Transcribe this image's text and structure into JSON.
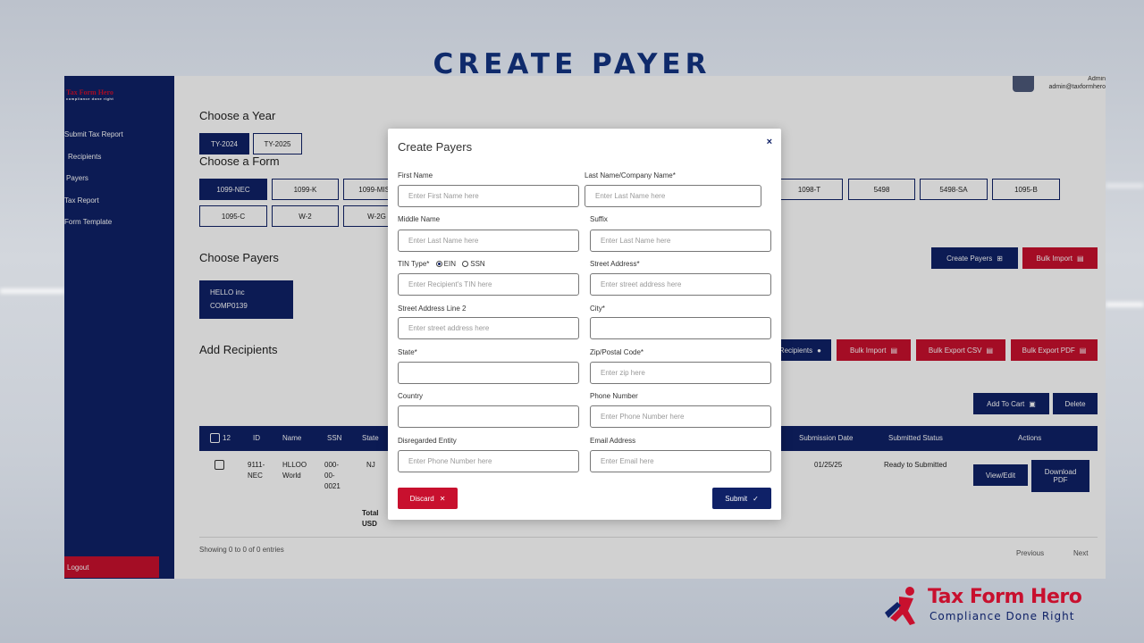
{
  "slide_title": "CREATE PAYER",
  "sidebar": {
    "logo_name": "Tax Form Hero",
    "logo_tag": "compliance done right",
    "items": [
      {
        "label": "Submit Tax Report"
      },
      {
        "label": "Recipients"
      },
      {
        "label": "Payers"
      },
      {
        "label": "Tax Report"
      },
      {
        "label": "Form Template"
      }
    ],
    "logout": "Logout"
  },
  "user": {
    "name": "Admin",
    "email": "admin@taxformhero"
  },
  "year": {
    "heading": "Choose a Year",
    "options": [
      "TY-2024",
      "TY-2025"
    ]
  },
  "form": {
    "heading": "Choose a Form",
    "row1": [
      "1099-NEC",
      "1099-K",
      "1099-MISC",
      "1098-T",
      "5498",
      "5498-SA",
      "1095-B"
    ],
    "row2": [
      "1095-C",
      "W-2",
      "W-2G"
    ]
  },
  "payers": {
    "heading": "Choose Payers",
    "create_btn": "Create Payers",
    "bulk_btn": "Bulk Import",
    "card_name": "HELLO inc",
    "card_id": "COMP0139"
  },
  "recipients": {
    "heading": "Add Recipients",
    "add_btn": "Recipients",
    "bulk_import": "Bulk Import",
    "export_csv": "Bulk Export CSV",
    "export_pdf": "Bulk Export PDF",
    "add_cart": "Add To Cart",
    "delete": "Delete"
  },
  "table": {
    "headers": {
      "count": "12",
      "id": "ID",
      "name": "Name",
      "ssn": "SSN",
      "state": "State",
      "submission_date": "Submission Date",
      "status": "Submitted Status",
      "actions": "Actions"
    },
    "row": {
      "id": "9111-NEC",
      "name": "HLLOO World",
      "ssn": "000-00-0021",
      "state": "NJ",
      "date": "01/25/25",
      "status": "Ready to Submitted",
      "view": "View/Edit",
      "download": "Download PDF"
    },
    "total": "Total USD",
    "showing": "Showing 0 to 0 of 0 entries",
    "previous": "Previous",
    "next": "Next"
  },
  "modal": {
    "title": "Create Payers",
    "close": "×",
    "first_name": {
      "label": "First Name",
      "placeholder": "Enter First Name here"
    },
    "last_name": {
      "label": "Last Name/Company Name*",
      "placeholder": "Enter Last Name here"
    },
    "middle_name": {
      "label": "Middle Name",
      "placeholder": "Enter Last Name here"
    },
    "suffix": {
      "label": "Suffix",
      "placeholder": "Enter Last Name here"
    },
    "tin": {
      "label": "TIN Type*",
      "ein": "EIN",
      "ssn": "SSN",
      "placeholder": "Enter Recipient's TIN here"
    },
    "street": {
      "label": "Street Address*",
      "placeholder": "Enter street address here"
    },
    "street2": {
      "label": "Street Address Line 2",
      "placeholder": "Enter street address here"
    },
    "city": {
      "label": "City*",
      "placeholder": ""
    },
    "state": {
      "label": "State*",
      "placeholder": ""
    },
    "zip": {
      "label": "Zip/Postal Code*",
      "placeholder": "Enter zip here"
    },
    "country": {
      "label": "Country",
      "placeholder": ""
    },
    "phone": {
      "label": "Phone Number",
      "placeholder": "Enter Phone Number here"
    },
    "disregarded": {
      "label": "Disregarded Entity",
      "placeholder": "Enter Phone Number here"
    },
    "email": {
      "label": "Email Address",
      "placeholder": "Enter Email here"
    },
    "discard": "Discard",
    "submit": "Submit"
  },
  "brand": {
    "name": "Tax Form Hero",
    "tagline": "Compliance Done Right"
  }
}
